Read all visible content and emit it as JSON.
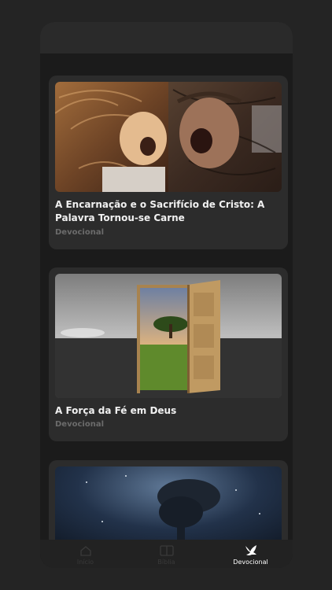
{
  "cards": [
    {
      "title": "A Encarnação e o Sacrifício de Cristo: A Palavra Tornou-se Carne",
      "category": "Devocional",
      "image": "child-and-christ-with-crown-of-thorns"
    },
    {
      "title": "A Força da Fé em Deus",
      "category": "Devocional",
      "image": "door-opening-to-green-field-with-tree"
    },
    {
      "title": "",
      "category": "",
      "image": "dark-starry-sky-with-tree"
    }
  ],
  "nav": {
    "items": [
      {
        "label": "Início",
        "icon": "home-icon",
        "active": false
      },
      {
        "label": "Bíblia",
        "icon": "bible-icon",
        "active": false
      },
      {
        "label": "Devocional",
        "icon": "dove-icon",
        "active": true
      }
    ]
  },
  "colors": {
    "background": "#242424",
    "card": "#2c2c2c",
    "active": "#ffffff",
    "muted": "#6b6b6b"
  }
}
